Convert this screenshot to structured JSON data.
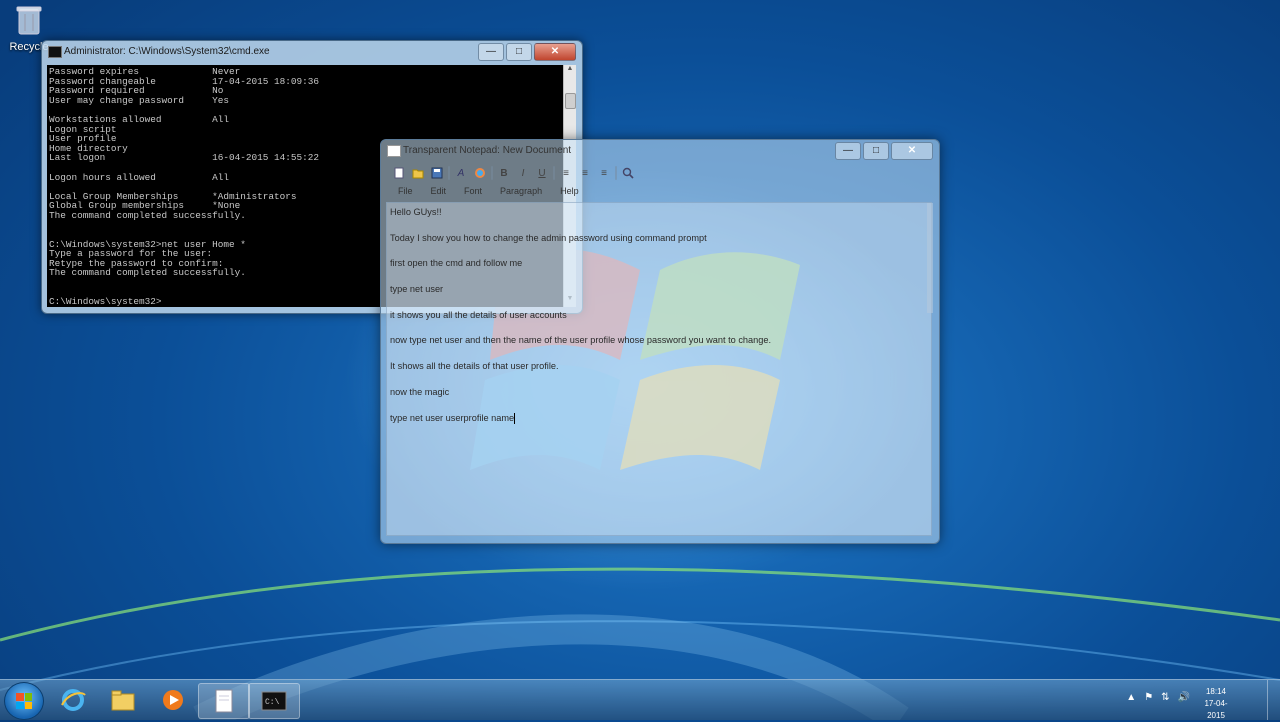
{
  "desktop": {
    "icons": [
      {
        "label": "Recycle",
        "icon": "recycle-bin-icon"
      }
    ]
  },
  "cmd_window": {
    "title": "Administrator: C:\\Windows\\System32\\cmd.exe",
    "controls": {
      "minimize": "—",
      "maximize": "□",
      "close": "✕"
    },
    "lines": [
      "Password expires             Never",
      "Password changeable          17-04-2015 18:09:36",
      "Password required            No",
      "User may change password     Yes",
      "",
      "Workstations allowed         All",
      "Logon script",
      "User profile",
      "Home directory",
      "Last logon                   16-04-2015 14:55:22",
      "",
      "Logon hours allowed          All",
      "",
      "Local Group Memberships      *Administrators",
      "Global Group memberships     *None",
      "The command completed successfully.",
      "",
      "",
      "C:\\Windows\\system32>net user Home *",
      "Type a password for the user:",
      "Retype the password to confirm:",
      "The command completed successfully.",
      "",
      "",
      "C:\\Windows\\system32>"
    ]
  },
  "notepad": {
    "title": "Transparent Notepad: New Document",
    "controls": {
      "minimize": "—",
      "maximize": "□",
      "close": "✕"
    },
    "toolbar": [
      "new-icon",
      "open-icon",
      "save-icon",
      "font-icon",
      "color-icon",
      "B",
      "I",
      "U",
      "align-left-icon",
      "align-center-icon",
      "align-right-icon",
      "find-icon"
    ],
    "menu": [
      "File",
      "Edit",
      "Font",
      "Paragraph",
      "Help"
    ],
    "lines": [
      "Hello GUys!!",
      "Today I show you how to change the admin password using command prompt",
      "first open the cmd and follow me",
      "type net user",
      "it shows you all the details of user accounts",
      "now type net user and then the name of the user profile whose password you want to change.",
      "It shows all the details of that user profile.",
      "now the magic",
      "type net user userprofile name"
    ]
  },
  "taskbar": {
    "start_icon": "windows-start-icon",
    "pinned": [
      "internet-explorer-icon",
      "file-explorer-icon",
      "media-player-icon",
      "notepad-icon",
      "cmd-icon"
    ],
    "tray_icons": [
      "show-hidden-icons",
      "network-icon",
      "volume-icon",
      "flag-icon"
    ],
    "clock": {
      "time": "18:14",
      "date": "17-04-2015"
    }
  }
}
